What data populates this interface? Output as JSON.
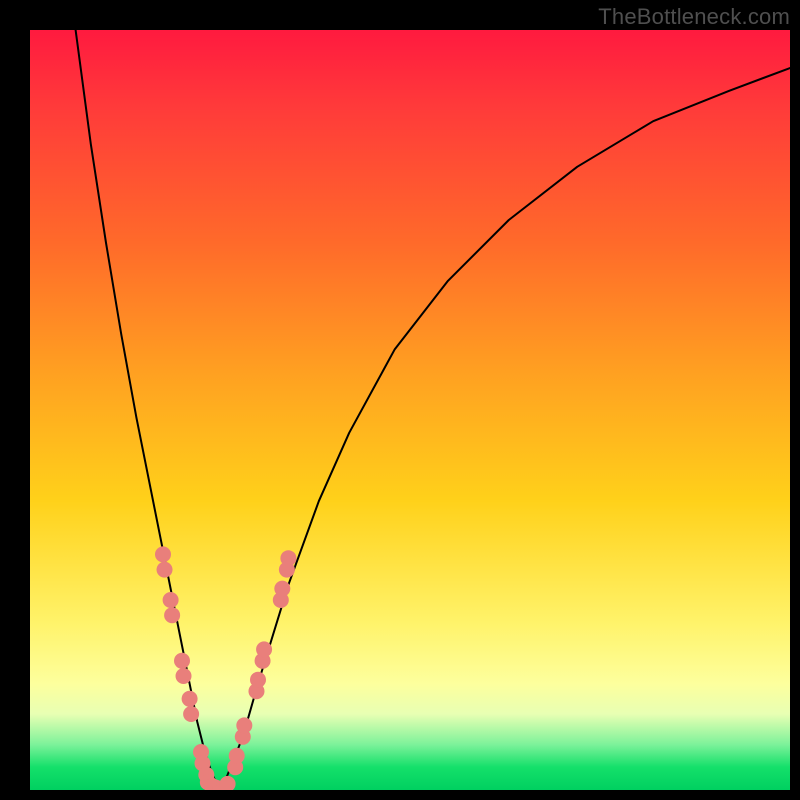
{
  "watermark": "TheBottleneck.com",
  "chart_data": {
    "type": "line",
    "title": "",
    "xlabel": "",
    "ylabel": "",
    "xlim": [
      0,
      100
    ],
    "ylim": [
      0,
      100
    ],
    "annotations": [],
    "series": [
      {
        "name": "curve",
        "x": [
          6,
          8,
          10,
          12,
          14,
          16,
          18,
          19,
          20,
          21,
          22,
          23,
          24,
          25,
          26,
          28,
          30,
          34,
          38,
          42,
          48,
          55,
          63,
          72,
          82,
          92,
          100
        ],
        "y": [
          100,
          85,
          72,
          60,
          49,
          39,
          29,
          24,
          19,
          14,
          9,
          5,
          2,
          0,
          2,
          7,
          14,
          27,
          38,
          47,
          58,
          67,
          75,
          82,
          88,
          92,
          95
        ],
        "stroke": "#000000",
        "stroke_width": 2
      },
      {
        "name": "dots-left",
        "x": [
          17.5,
          17.7,
          18.5,
          18.7,
          20.0,
          20.2,
          21.0,
          21.2,
          22.5,
          22.7,
          23.2,
          23.4
        ],
        "y": [
          31,
          29,
          25,
          23,
          17,
          15,
          12,
          10,
          5,
          3.5,
          2,
          1
        ],
        "marker_color": "#e97f7b",
        "marker_radius_px": 8
      },
      {
        "name": "dots-bottom",
        "x": [
          24.0,
          24.5,
          25.0,
          25.5,
          26.0
        ],
        "y": [
          0.5,
          0.3,
          0.2,
          0.3,
          0.8
        ],
        "marker_color": "#e97f7b",
        "marker_radius_px": 8
      },
      {
        "name": "dots-right",
        "x": [
          27.0,
          27.2,
          28.0,
          28.2,
          29.8,
          30.0,
          30.6,
          30.8,
          33.0,
          33.2,
          33.8,
          34.0
        ],
        "y": [
          3,
          4.5,
          7,
          8.5,
          13,
          14.5,
          17,
          18.5,
          25,
          26.5,
          29,
          30.5
        ],
        "marker_color": "#e97f7b",
        "marker_radius_px": 8
      }
    ]
  }
}
